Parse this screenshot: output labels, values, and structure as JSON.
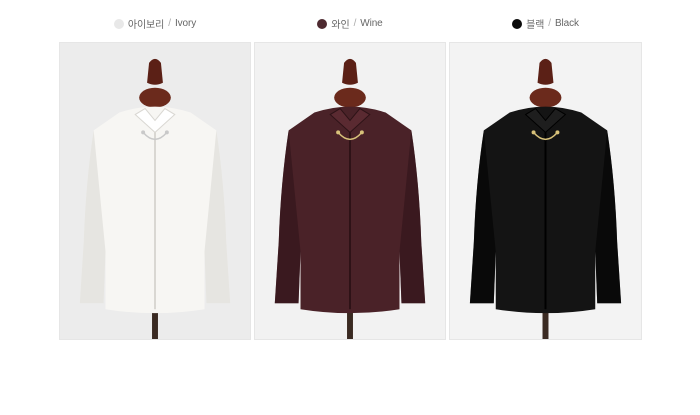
{
  "colors": [
    {
      "name_ko": "아이보리",
      "separator": "/",
      "name_en": "Ivory",
      "swatch": "#e8e8e8",
      "shirt": "#f7f6f3",
      "shirt_shade": "#d9d7d2",
      "photo_bg": "#ececec",
      "brooch": "#c9c9c9"
    },
    {
      "name_ko": "와인",
      "separator": "/",
      "name_en": "Wine",
      "swatch": "#4e2a30",
      "shirt": "#4a2228",
      "shirt_shade": "#2e1317",
      "photo_bg": "#f2f2f2",
      "brooch": "#d8c27a"
    },
    {
      "name_ko": "블랙",
      "separator": "/",
      "name_en": "Black",
      "swatch": "#0a0a0a",
      "shirt": "#141414",
      "shirt_shade": "#000000",
      "photo_bg": "#f3f3f3",
      "brooch": "#d8c27a"
    }
  ]
}
